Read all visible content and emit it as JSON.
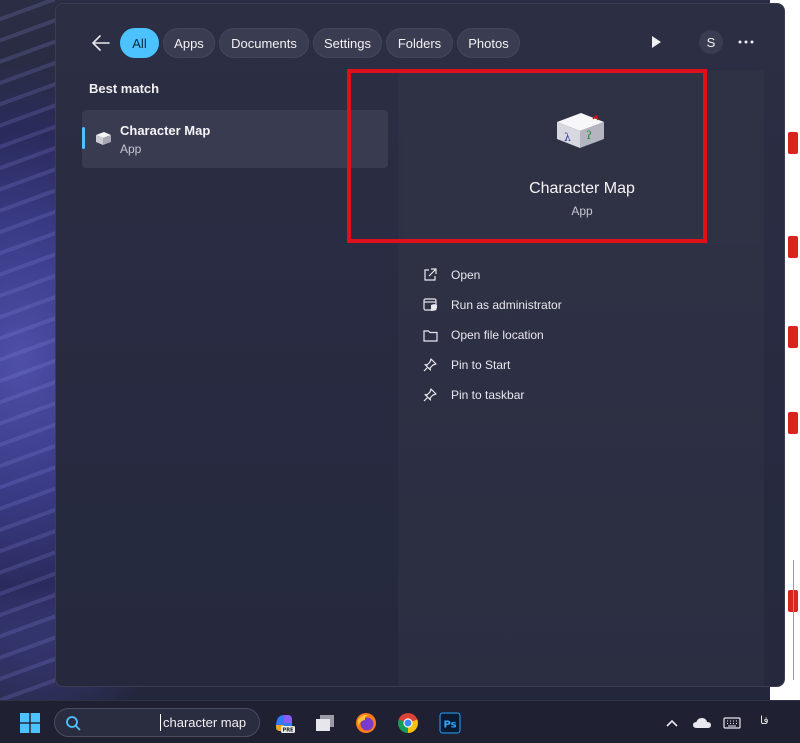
{
  "search_panel": {
    "filters": [
      {
        "label": "All",
        "active": true
      },
      {
        "label": "Apps",
        "active": false
      },
      {
        "label": "Documents",
        "active": false
      },
      {
        "label": "Settings",
        "active": false
      },
      {
        "label": "Folders",
        "active": false
      },
      {
        "label": "Photos",
        "active": false
      }
    ],
    "avatar_initial": "S",
    "best_match_title": "Best match",
    "best_match": {
      "name": "Character Map",
      "type": "App"
    },
    "detail": {
      "title": "Character Map",
      "type": "App",
      "highlight_color": "#e0101b",
      "actions": [
        {
          "label": "Open",
          "icon": "open-external-icon"
        },
        {
          "label": "Run as administrator",
          "icon": "shield-app-icon"
        },
        {
          "label": "Open file location",
          "icon": "folder-icon"
        },
        {
          "label": "Pin to Start",
          "icon": "pin-icon"
        },
        {
          "label": "Pin to taskbar",
          "icon": "pin-icon"
        }
      ]
    },
    "accent_color": "#4cc2ff"
  },
  "taskbar": {
    "search_value": "character map",
    "apps": [
      "copilot-pre-icon",
      "task-view-icon",
      "firefox-icon",
      "chrome-icon",
      "photoshop-icon"
    ],
    "photoshop_label": "Ps",
    "copilot_badge": "PRE",
    "language_indicator": "فا"
  }
}
